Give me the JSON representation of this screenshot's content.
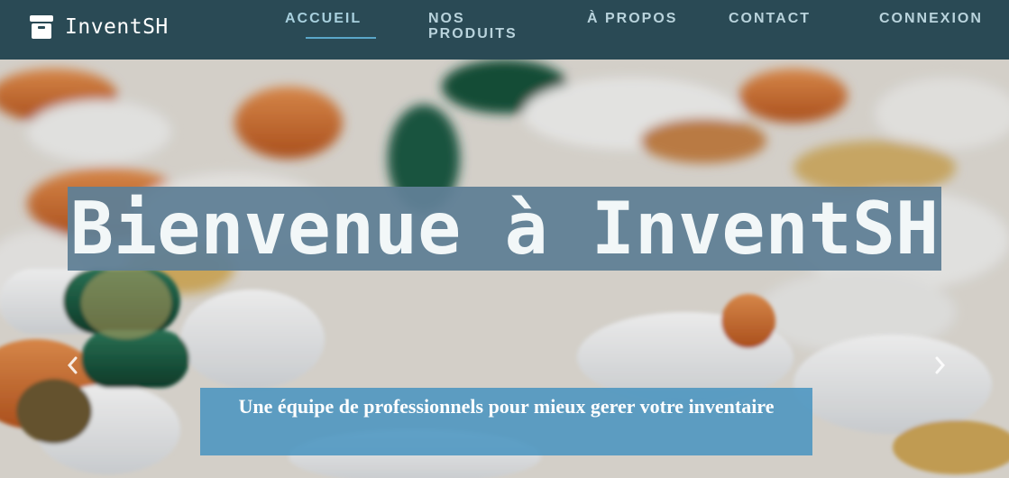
{
  "brand": {
    "name": "InventSH",
    "icon": "box-icon"
  },
  "nav": {
    "items": [
      {
        "label": "ACCUEIL",
        "active": true
      },
      {
        "label": "NOS PRODUITS",
        "active": false
      },
      {
        "label": "À PROPOS",
        "active": false
      },
      {
        "label": "CONTACT",
        "active": false
      },
      {
        "label": "CONNEXION",
        "active": false
      }
    ]
  },
  "hero": {
    "title": "Bienvenue à InventSH",
    "subtitle": "Une équipe de professionnels pour mieux gerer votre inventaire",
    "prev_icon": "chevron-left-icon",
    "next_icon": "chevron-right-icon"
  },
  "colors": {
    "navbar": "#2a4a55",
    "nav_text": "#b9d3dc",
    "accent": "#5aa6c8",
    "title_bg": "#607f96",
    "subtitle_bg": "#4693bf"
  }
}
